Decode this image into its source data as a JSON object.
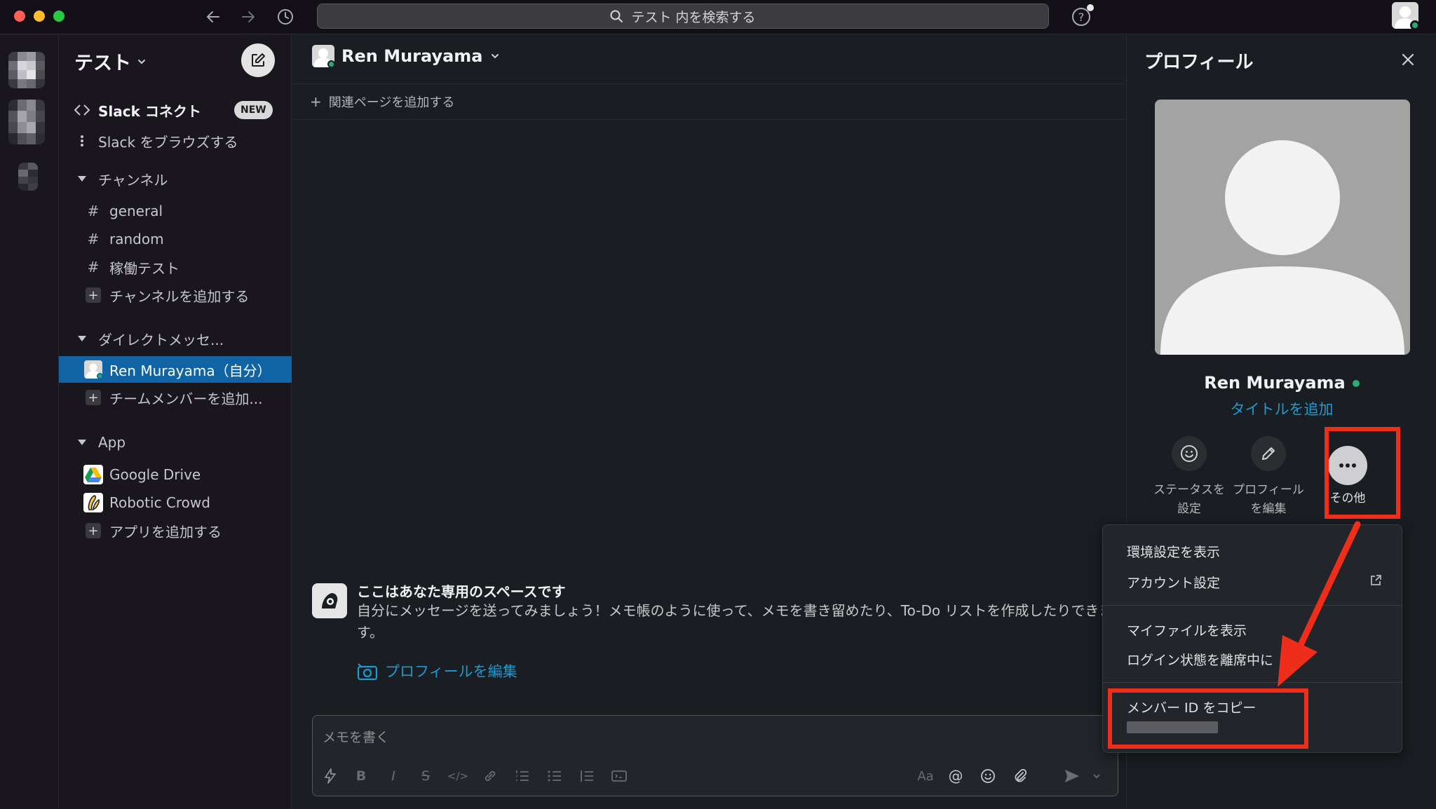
{
  "titlebar": {
    "search_placeholder": "テスト 内を検索する",
    "help": "?"
  },
  "sidebar": {
    "workspace_name": "テスト",
    "connect": {
      "label": "Slack コネクト",
      "badge": "NEW"
    },
    "browse": "Slack をブラウズする",
    "channels_header": "チャンネル",
    "channels": [
      "general",
      "random",
      "稼働テスト"
    ],
    "add_channel": "チャンネルを追加する",
    "dm_header": "ダイレクトメッセ...",
    "dms": [
      {
        "label": "Ren Murayama（自分）",
        "active": true
      }
    ],
    "add_member": "チームメンバーを追加...",
    "apps_header": "App",
    "apps": [
      "Google Drive",
      "Robotic Crowd"
    ],
    "add_app": "アプリを追加する"
  },
  "main": {
    "title": "Ren Murayama",
    "bookmark": "関連ページを追加する",
    "intro_title": "ここはあなた専用のスペースです",
    "intro_body": "自分にメッセージを送ってみましょう！メモ帳のように使って、メモを書き留めたり、To-Do リストを作成したりできます。",
    "edit_profile_link": "プロフィールを編集",
    "composer_placeholder": "メモを書く",
    "formatting_label": "Aa"
  },
  "profile": {
    "header": "プロフィール",
    "name": "Ren Murayama",
    "add_title": "タイトルを追加",
    "actions": {
      "status": [
        "ステータスを",
        "設定"
      ],
      "edit": [
        "プロフィール",
        "を編集"
      ],
      "more": "その他"
    }
  },
  "menu": {
    "items": [
      "環境設定を表示",
      "アカウント設定",
      "マイファイルを表示",
      "ログイン状態を離席中に",
      "メンバー ID をコピー"
    ]
  },
  "colors": {
    "accent_red": "#ee2d1b",
    "link_blue": "#1d9bd1",
    "active_blue": "#1164a3",
    "presence_green": "#2bac76",
    "background": "#1a1d21"
  }
}
